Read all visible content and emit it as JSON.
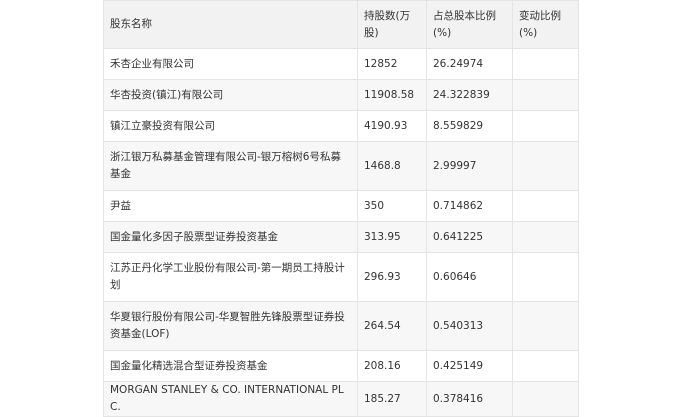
{
  "table": {
    "headers": {
      "name": "股东名称",
      "shares": "持股数(万股)",
      "ratio": "占总股本比例(%)",
      "change": "变动比例(%)"
    },
    "rows": [
      {
        "name": "禾杏企业有限公司",
        "shares": "12852",
        "ratio": "26.24974",
        "change": ""
      },
      {
        "name": "华杏投资(镇江)有限公司",
        "shares": "11908.58",
        "ratio": "24.322839",
        "change": ""
      },
      {
        "name": "镇江立豪投资有限公司",
        "shares": "4190.93",
        "ratio": "8.559829",
        "change": ""
      },
      {
        "name": "浙江银万私募基金管理有限公司-银万榕树6号私募基金",
        "shares": "1468.8",
        "ratio": "2.99997",
        "change": ""
      },
      {
        "name": "尹益",
        "shares": "350",
        "ratio": "0.714862",
        "change": ""
      },
      {
        "name": "国金量化多因子股票型证券投资基金",
        "shares": "313.95",
        "ratio": "0.641225",
        "change": ""
      },
      {
        "name": "江苏正丹化学工业股份有限公司-第一期员工持股计划",
        "shares": "296.93",
        "ratio": "0.60646",
        "change": ""
      },
      {
        "name": "华夏银行股份有限公司-华夏智胜先锋股票型证券投资基金(LOF)",
        "shares": "264.54",
        "ratio": "0.540313",
        "change": ""
      },
      {
        "name": "国金量化精选混合型证券投资基金",
        "shares": "208.16",
        "ratio": "0.425149",
        "change": ""
      },
      {
        "name": "MORGAN STANLEY & CO. INTERNATIONAL PLC.",
        "shares": "185.27",
        "ratio": "0.378416",
        "change": ""
      }
    ]
  }
}
